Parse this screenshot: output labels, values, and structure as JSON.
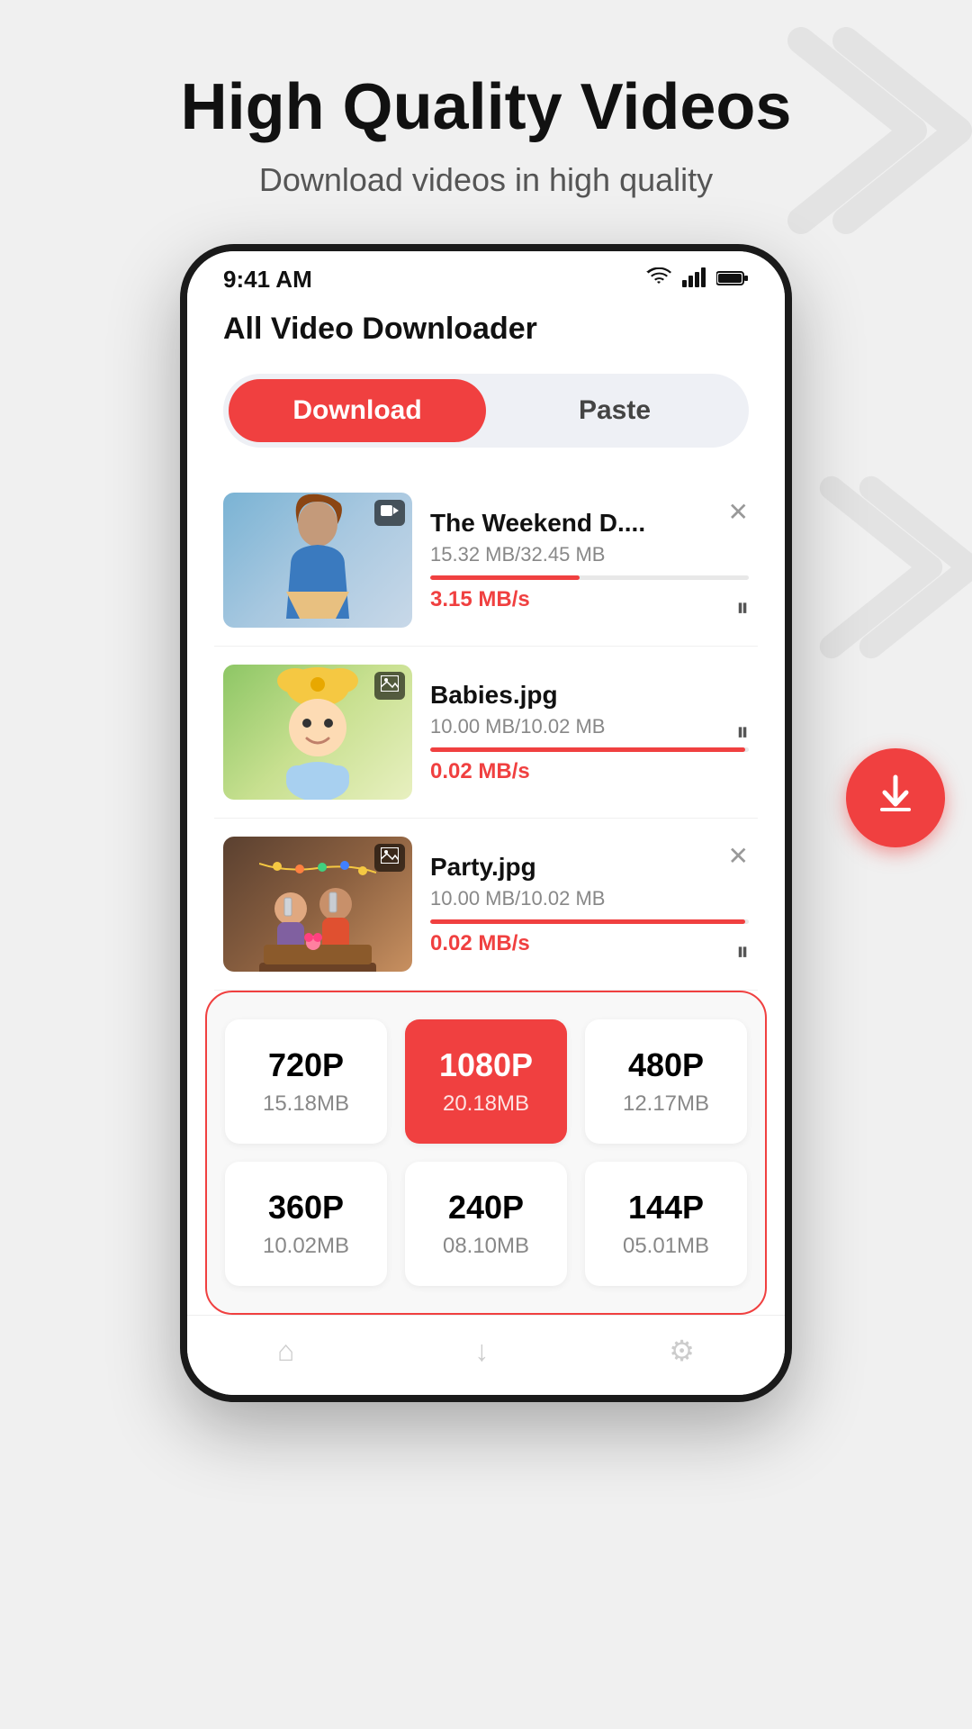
{
  "page": {
    "background_color": "#f0f0f0"
  },
  "header": {
    "title": "High Quality Videos",
    "subtitle": "Download videos in high quality"
  },
  "phone": {
    "status_bar": {
      "time": "9:41 AM"
    },
    "app_title": "All Video Downloader",
    "tabs": [
      {
        "label": "Download",
        "active": true
      },
      {
        "label": "Paste",
        "active": false
      }
    ],
    "downloads": [
      {
        "name": "The Weekend D....",
        "size": "15.32 MB/32.45 MB",
        "speed": "3.15 MB/s",
        "progress": 47,
        "type": "video",
        "has_close": true,
        "has_pause": true
      },
      {
        "name": "Babies.jpg",
        "size": "10.00 MB/10.02 MB",
        "speed": "0.02 MB/s",
        "progress": 99,
        "type": "image",
        "has_close": false,
        "has_pause": true
      },
      {
        "name": "Party.jpg",
        "size": "10.00 MB/10.02 MB",
        "speed": "0.02 MB/s",
        "progress": 99,
        "type": "image",
        "has_close": true,
        "has_pause": true
      }
    ],
    "quality_options": [
      {
        "res": "720P",
        "size": "15.18MB",
        "selected": false
      },
      {
        "res": "1080P",
        "size": "20.18MB",
        "selected": true
      },
      {
        "res": "480P",
        "size": "12.17MB",
        "selected": false
      },
      {
        "res": "360P",
        "size": "10.02MB",
        "selected": false
      },
      {
        "res": "240P",
        "size": "08.10MB",
        "selected": false
      },
      {
        "res": "144P",
        "size": "05.01MB",
        "selected": false
      }
    ]
  }
}
